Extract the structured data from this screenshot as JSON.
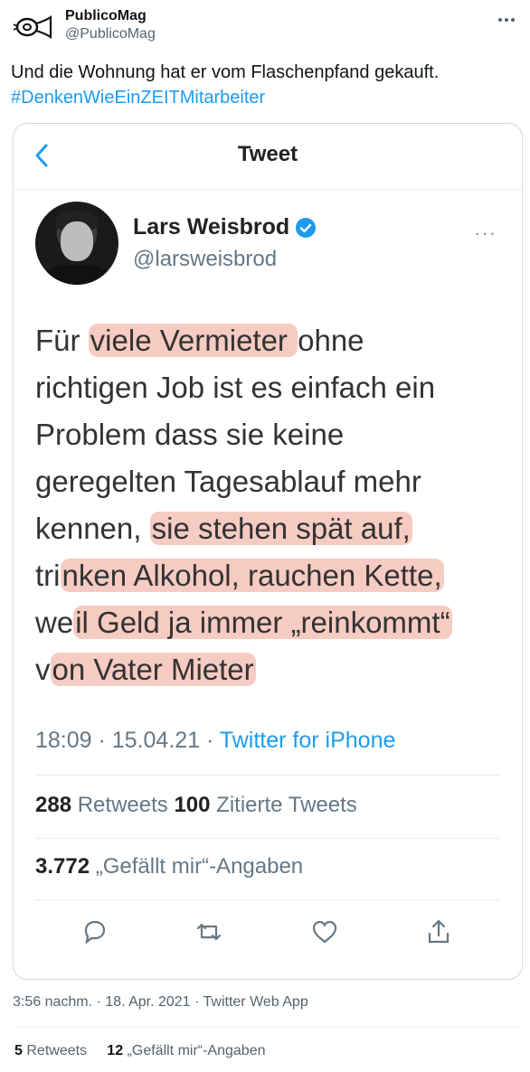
{
  "tweet": {
    "author": {
      "display_name": "PublicoMag",
      "handle": "@PublicoMag",
      "avatar_icon": "posthorn-logo-icon"
    },
    "text": "Und die Wohnung hat er vom Flaschenpfand gekauft.",
    "hashtag": "#DenkenWieEinZEITMitarbeiter",
    "timestamp": "3:56 nachm. · 18. Apr. 2021 · Twitter Web App",
    "retweets_count": "5",
    "retweets_label": "Retweets",
    "likes_count": "12",
    "likes_label": "„Gefällt mir“-Angaben"
  },
  "screenshot": {
    "title": "Tweet",
    "author": {
      "display_name": "Lars Weisbrod",
      "handle": "@larsweisbrod"
    },
    "more": "···",
    "lines": [
      {
        "pre": "Für ",
        "hl": "viele Vermieter ",
        "post": "ohne"
      },
      {
        "pre": "richtigen Job  ist es einfach ein",
        "hl": "",
        "post": ""
      },
      {
        "pre": "Problem dass sie keine",
        "hl": "",
        "post": ""
      },
      {
        "pre": "geregelten Tagesablauf mehr",
        "hl": "",
        "post": ""
      },
      {
        "pre": "kennen, ",
        "hl": "sie stehen spät auf,",
        "post": ""
      },
      {
        "pre": "tri",
        "hl": "nken Alkohol, rauchen Kette,",
        "post": ""
      },
      {
        "pre": "we",
        "hl": "il Geld ja immer „reinkommt“",
        "post": ""
      },
      {
        "pre": "v",
        "hl": "on Vater Mieter",
        "post": ""
      }
    ],
    "time_date": "18:09 · 15.04.21 · ",
    "client": "Twitter for iPhone",
    "retweets_num": "288",
    "retweets_label": " Retweets  ",
    "quotes_num": "100",
    "quotes_label": " Zitierte Tweets",
    "likes_num": "3.772",
    "likes_label": " „Gefällt mir“-Angaben",
    "highlight_color": "#ea8c78",
    "accent": "#1d9bf0"
  }
}
